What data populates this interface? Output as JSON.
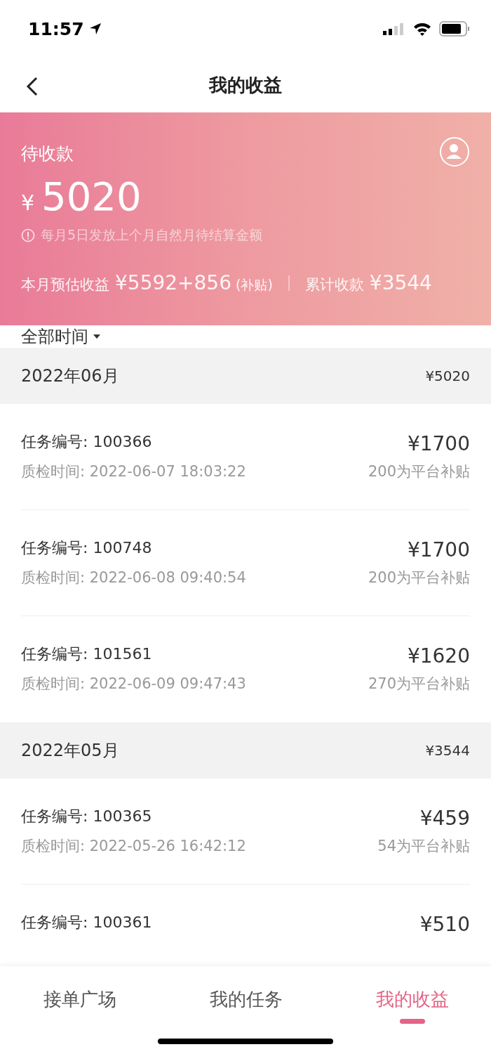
{
  "status_bar": {
    "time": "11:57"
  },
  "nav_bar": {
    "title": "我的收益"
  },
  "summary": {
    "label": "待收款",
    "currency": "¥",
    "amount": "5020",
    "notice": "每月5日发放上个月自然月待结算金额",
    "month_estimate_label": "本月预估收益",
    "month_estimate_value": "¥5592+856",
    "month_estimate_note": "(补贴)",
    "total_label": "累计收款",
    "total_value": "¥3544"
  },
  "filter": {
    "label": "全部时间"
  },
  "groups": [
    {
      "month": "2022年06月",
      "total": "¥5020",
      "items": [
        {
          "task_id": "任务编号: 100366",
          "inspected_at": "质检时间: 2022-06-07 18:03:22",
          "amount": "¥1700",
          "subsidy": "200为平台补贴"
        },
        {
          "task_id": "任务编号: 100748",
          "inspected_at": "质检时间: 2022-06-08 09:40:54",
          "amount": "¥1700",
          "subsidy": "200为平台补贴"
        },
        {
          "task_id": "任务编号: 101561",
          "inspected_at": "质检时间: 2022-06-09 09:47:43",
          "amount": "¥1620",
          "subsidy": "270为平台补贴"
        }
      ]
    },
    {
      "month": "2022年05月",
      "total": "¥3544",
      "items": [
        {
          "task_id": "任务编号: 100365",
          "inspected_at": "质检时间: 2022-05-26 16:42:12",
          "amount": "¥459",
          "subsidy": "54为平台补贴"
        },
        {
          "task_id": "任务编号: 100361",
          "amount": "¥510"
        }
      ]
    }
  ],
  "tabs": [
    {
      "label": "接单广场",
      "selected": false
    },
    {
      "label": "我的任务",
      "selected": false
    },
    {
      "label": "我的收益",
      "selected": true
    }
  ]
}
